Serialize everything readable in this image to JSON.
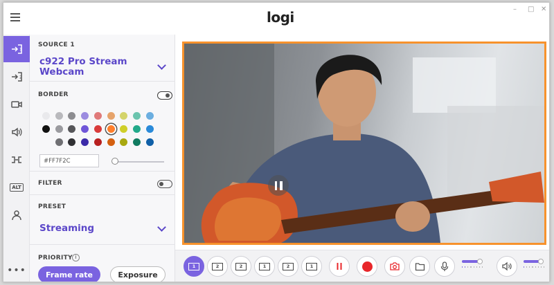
{
  "app": {
    "logo": "logi",
    "window_controls": [
      "–",
      "□",
      "✕"
    ]
  },
  "rail": {
    "items": [
      {
        "name": "source-1",
        "label": "→1",
        "active": true
      },
      {
        "name": "source-2",
        "label": "→2",
        "active": false
      },
      {
        "name": "camera",
        "label": "",
        "active": false
      },
      {
        "name": "audio",
        "label": "",
        "active": false
      },
      {
        "name": "transitions",
        "label": "",
        "active": false
      },
      {
        "name": "alt",
        "label": "ALT",
        "active": false
      },
      {
        "name": "profile",
        "label": "",
        "active": false
      }
    ],
    "more": "•••"
  },
  "panel": {
    "source_label": "SOURCE 1",
    "source_name": "c922 Pro Stream Webcam",
    "border_label": "BORDER",
    "border_enabled": true,
    "border_hex": "#FF7F2C",
    "border_opacity": 0.05,
    "filter_label": "FILTER",
    "filter_enabled": false,
    "preset_label": "PRESET",
    "preset_value": "Streaming",
    "priority_label": "PRIORITY",
    "priority_info": "i",
    "priority_options": [
      "Frame rate",
      "Exposure"
    ],
    "priority_selected": "Frame rate"
  },
  "swatches": [
    [
      "#e9e9ec",
      "#b9b9bd",
      "#8c8c90",
      "#9c8ce0",
      "#e07a7a",
      "#e6a36b",
      "#d4d46b",
      "#6bc4ae",
      "#6baee0"
    ],
    [
      "#111111",
      "#9a9a9f",
      "#555559",
      "#6f55d8",
      "#d93b3b",
      "#ff7f2c",
      "#cfcf2a",
      "#22a98a",
      "#2a8ad9"
    ],
    [
      "",
      "#6f6f73",
      "#2f2f33",
      "#3b2aa8",
      "#b82020",
      "#d46010",
      "#a8a810",
      "#107a60",
      "#1060a8"
    ]
  ],
  "toolbar": {
    "scenes": [
      "1",
      "2",
      "2",
      "1",
      "2",
      "1"
    ],
    "active_scene": 0,
    "mic_level": 0.9,
    "speaker_level": 0.85
  },
  "colors": {
    "accent": "#7a63e0",
    "border": "#f7922c",
    "record": "#e8262a"
  }
}
